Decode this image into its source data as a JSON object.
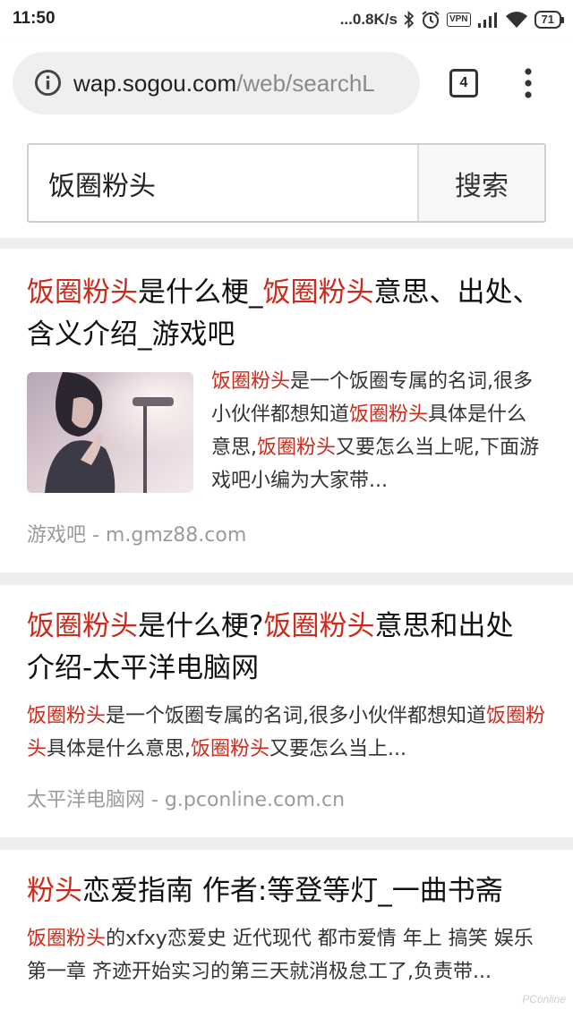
{
  "status_bar": {
    "time": "11:50",
    "net_speed": "...0.8K/s",
    "vpn": "VPN",
    "battery": "71",
    "icons": [
      "bluetooth-icon",
      "alarm-icon",
      "signal-icon",
      "wifi-icon"
    ]
  },
  "browser": {
    "url_host": "wap.sogou.com",
    "url_path": "/web/searchL",
    "tab_count": "4"
  },
  "search": {
    "query": "饭圈粉头",
    "button_label": "搜索"
  },
  "results": [
    {
      "title": [
        {
          "t": "饭圈粉头",
          "hl": true
        },
        {
          "t": "是什么梗_",
          "hl": false
        },
        {
          "t": "饭圈粉头",
          "hl": true
        },
        {
          "t": "意思、出处、含义介绍_游戏吧",
          "hl": false
        }
      ],
      "snippet": [
        {
          "t": "饭圈粉头",
          "hl": true
        },
        {
          "t": "是一个饭圈专属的名词,很多小伙伴都想知道",
          "hl": false
        },
        {
          "t": "饭圈粉头",
          "hl": true
        },
        {
          "t": "具体是什么意思,",
          "hl": false
        },
        {
          "t": "饭圈粉头",
          "hl": true
        },
        {
          "t": "又要怎么当上呢,下面游戏吧小编为大家带...",
          "hl": false
        }
      ],
      "source": "游戏吧 - m.gmz88.com"
    },
    {
      "title": [
        {
          "t": "饭圈粉头",
          "hl": true
        },
        {
          "t": "是什么梗?",
          "hl": false
        },
        {
          "t": "饭圈粉头",
          "hl": true
        },
        {
          "t": "意思和出处介绍-太平洋电脑网",
          "hl": false
        }
      ],
      "snippet": [
        {
          "t": "饭圈粉头",
          "hl": true
        },
        {
          "t": "是一个饭圈专属的名词,很多小伙伴都想知道",
          "hl": false
        },
        {
          "t": "饭圈粉头",
          "hl": true
        },
        {
          "t": "具体是什么意思,",
          "hl": false
        },
        {
          "t": "饭圈粉头",
          "hl": true
        },
        {
          "t": "又要怎么当上...",
          "hl": false
        }
      ],
      "source": "太平洋电脑网 - g.pconline.com.cn"
    },
    {
      "title": [
        {
          "t": "粉头",
          "hl": true
        },
        {
          "t": "恋爱指南 作者:等登等灯_一曲书斋",
          "hl": false
        }
      ],
      "snippet": [
        {
          "t": "饭圈粉头",
          "hl": true
        },
        {
          "t": "的xfxy恋爱史 近代现代 都市爱情 年上 搞笑 娱乐 第一章 齐迹开始实习的第三天就消极怠工了,负责带...",
          "hl": false
        }
      ],
      "source": ""
    }
  ],
  "watermark": "PConline",
  "colors": {
    "highlight": "#cc2a1a",
    "source_gray": "#9b9b9b",
    "separator": "#eeeeee"
  }
}
